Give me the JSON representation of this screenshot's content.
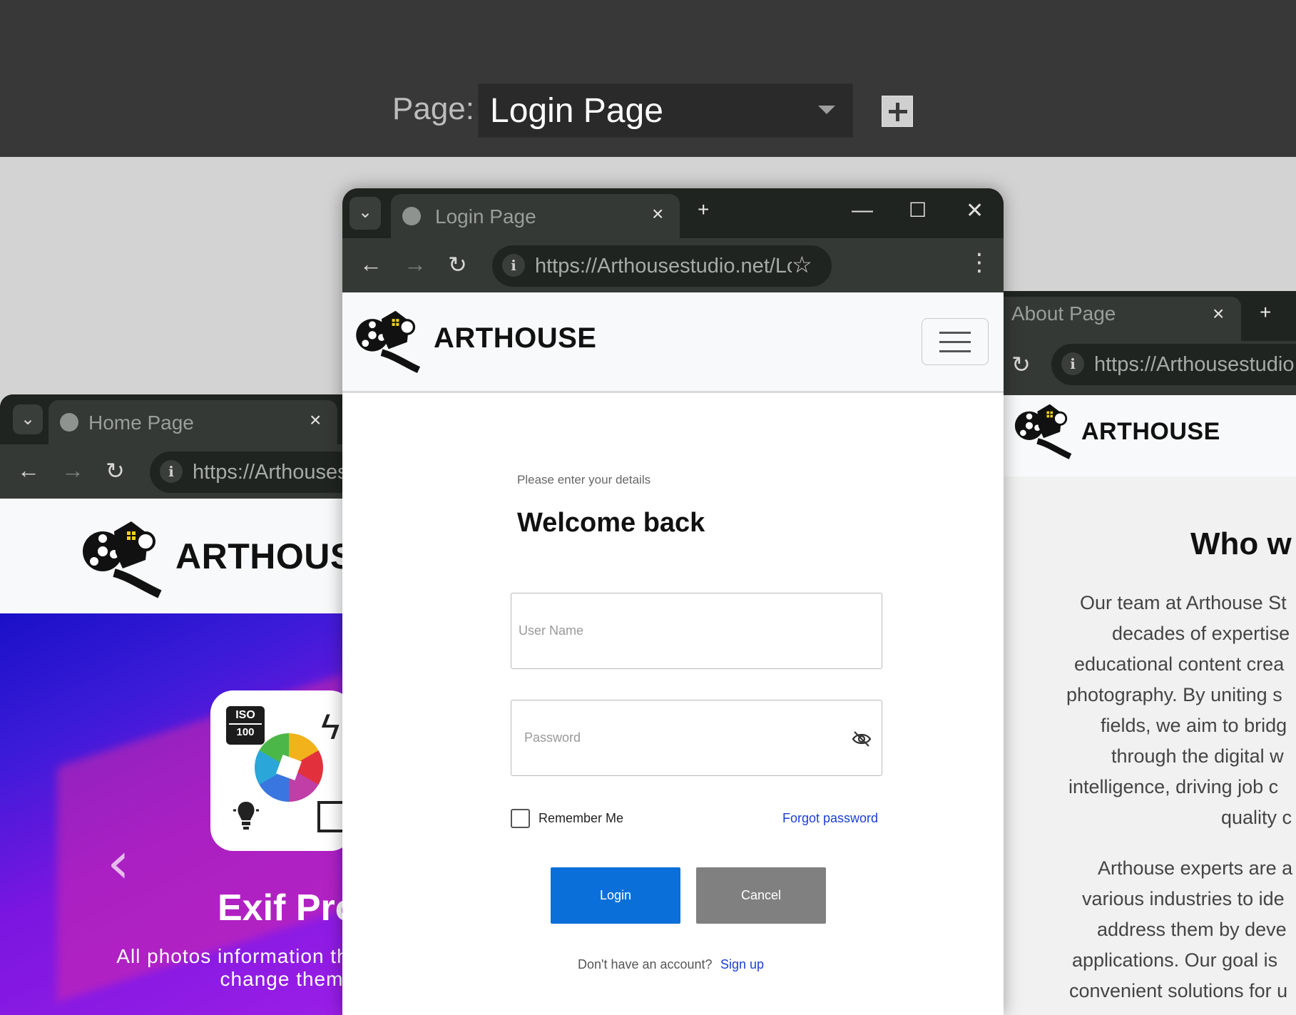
{
  "top_bar": {
    "page_label": "Page:",
    "selected_page": "Login Page",
    "add_icon": "plus-icon"
  },
  "home_window": {
    "tab_title": "Home Page",
    "tab_close": "×",
    "url": "https://Arthousestudio.net/",
    "brand": "ARTHOUSE",
    "hero": {
      "title": "Exif Pro",
      "subtitle": "All photos information the ability to change them",
      "iso_top": "ISO",
      "iso_bottom": "100",
      "prev_arrow": "‹"
    },
    "colors": {
      "hero_start": "#1a10c8",
      "hero_end": "#9a1ee6"
    }
  },
  "login_window": {
    "tab_title": "Login Page",
    "tab_close": "×",
    "new_tab": "+",
    "window_controls": {
      "minimize": "—",
      "maximize": "☐",
      "close": "✕"
    },
    "url": "https://Arthousestudio.net/Lo",
    "brand": "ARTHOUSE",
    "form": {
      "hint": "Please enter your details",
      "title": "Welcome back",
      "username_placeholder": "User Name",
      "username_value": "",
      "password_placeholder": "Password",
      "password_value": "",
      "remember_label": "Remember Me",
      "remember_checked": false,
      "forgot_link": "Forgot password",
      "login_button": "Login",
      "cancel_button": "Cancel",
      "signup_hint": "Don't have an account?",
      "signup_link": "Sign up"
    },
    "colors": {
      "primary": "#0a6fd8",
      "secondary": "#808080",
      "link": "#1a3fd6"
    }
  },
  "about_window": {
    "tab_title": "About Page",
    "tab_close": "×",
    "new_tab": "+",
    "url": "https://Arthousestudio.n",
    "brand": "ARTHOUSE",
    "heading": "Who w",
    "para1": [
      "Our team at Arthouse St",
      "decades of expertise",
      "educational content crea",
      "photography. By uniting s",
      "fields, we aim to bridg",
      "through the digital w",
      "intelligence, driving job c",
      "quality c"
    ],
    "para2": [
      "Arthouse experts are a",
      "various industries to ide",
      "address them by deve",
      "applications. Our goal is",
      "convenient solutions for u"
    ]
  }
}
